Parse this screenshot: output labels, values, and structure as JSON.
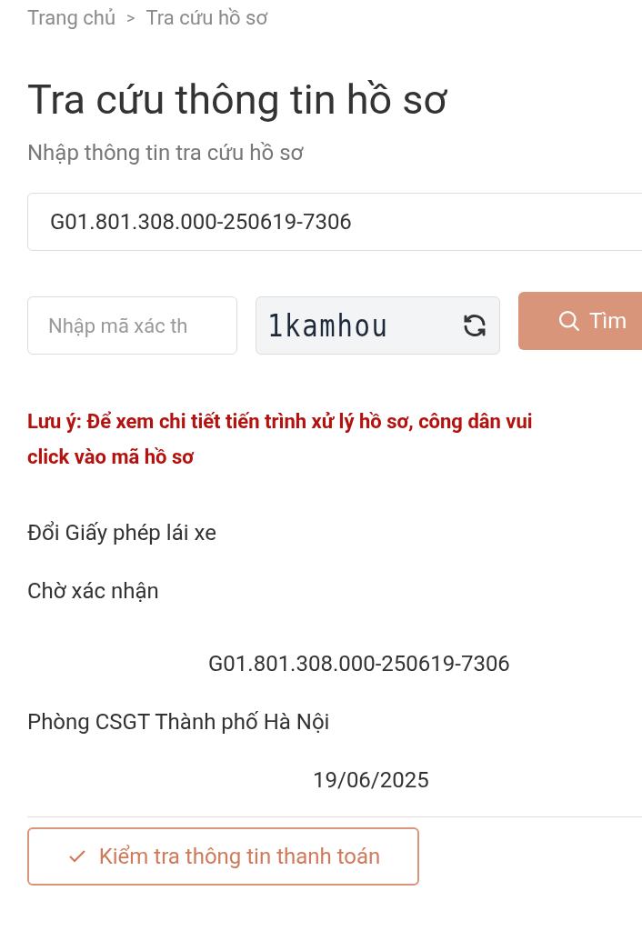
{
  "breadcrumb": [
    {
      "label": "Trang chủ"
    },
    {
      "label": "Tra cứu hồ sơ"
    }
  ],
  "breadcrumb_separator": ">",
  "title": "Tra cứu thông tin hồ sơ",
  "subtitle": "Nhập thông tin tra cứu hồ sơ",
  "record_field": {
    "value": "G01.801.308.000-250619-7306"
  },
  "captcha_field": {
    "placeholder": "Nhập mã xác th"
  },
  "captcha_text": "1kamhou",
  "search_button": {
    "label": "Tìm"
  },
  "note_lines": [
    "Lưu ý: Để xem chi tiết tiến trình xử lý hồ sơ, công dân vui",
    "click vào mã hồ sơ"
  ],
  "result": {
    "procedure": "Đổi Giấy phép lái xe",
    "status": "Chờ xác nhận",
    "code": "G01.801.308.000-250619-7306",
    "agency": "Phòng CSGT Thành phố Hà Nội",
    "date": "19/06/2025"
  },
  "payment_button": {
    "label": "Kiểm tra thông tin thanh toán"
  }
}
